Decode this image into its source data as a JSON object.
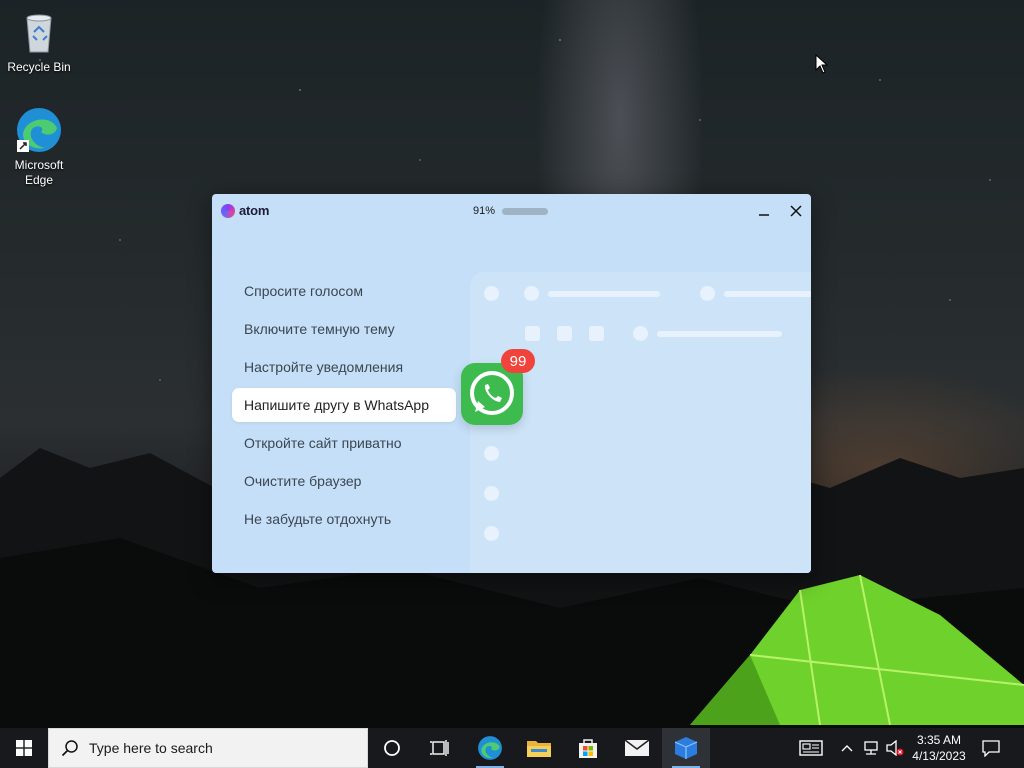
{
  "desktop": {
    "icons": [
      {
        "label": "Recycle Bin",
        "icon": "recycle-bin-icon"
      },
      {
        "label": "Microsoft Edge",
        "icon": "edge-icon"
      }
    ]
  },
  "atom_window": {
    "app_name": "atom",
    "battery_percent_label": "91%",
    "battery_level": 0.91,
    "tips": [
      {
        "label": "Спросите голосом",
        "active": false
      },
      {
        "label": "Включите темную тему",
        "active": false
      },
      {
        "label": "Настройте уведомления",
        "active": false
      },
      {
        "label": "Напишите другу в WhatsApp",
        "active": true
      },
      {
        "label": "Откройте сайт приватно",
        "active": false
      },
      {
        "label": "Очистите браузер",
        "active": false
      },
      {
        "label": "Не забудьте отдохнуть",
        "active": false
      }
    ],
    "whatsapp_badge": "99",
    "colors": {
      "background": "#c4dff7",
      "badge": "#f0433b",
      "whatsapp": "#3dbb4f"
    }
  },
  "taskbar": {
    "search_placeholder": "Type here to search",
    "pinned": [
      "cortana-icon",
      "task-view-icon",
      "edge-icon",
      "file-explorer-icon",
      "microsoft-store-icon",
      "mail-icon",
      "atom-app-icon"
    ],
    "clock": {
      "time": "3:35 AM",
      "date": "4/13/2023"
    }
  }
}
